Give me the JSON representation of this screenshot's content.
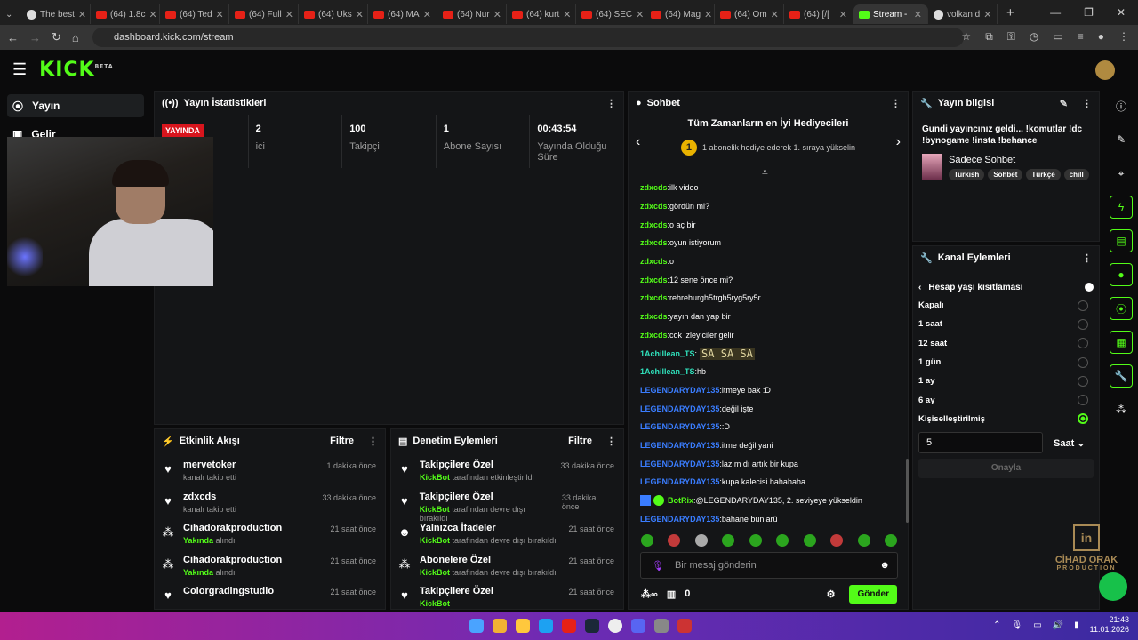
{
  "browser": {
    "tabs": [
      {
        "label": "The best",
        "kind": "g"
      },
      {
        "label": "(64) 1.8c",
        "kind": "yt"
      },
      {
        "label": "(64) Ted",
        "kind": "yt"
      },
      {
        "label": "(64) Full",
        "kind": "yt"
      },
      {
        "label": "(64) Uks",
        "kind": "yt"
      },
      {
        "label": "(64) MA",
        "kind": "yt"
      },
      {
        "label": "(64) Nur",
        "kind": "yt"
      },
      {
        "label": "(64) kurt",
        "kind": "yt"
      },
      {
        "label": "(64) SEC",
        "kind": "yt"
      },
      {
        "label": "(64) Mag",
        "kind": "yt"
      },
      {
        "label": "(64) Om",
        "kind": "yt"
      },
      {
        "label": "(64) [/[",
        "kind": "yt"
      },
      {
        "label": "Stream -",
        "kind": "active"
      },
      {
        "label": "volkan d",
        "kind": "g"
      }
    ],
    "url": "dashboard.kick.com/stream"
  },
  "brand": {
    "logo": "KICK",
    "beta": "BETA",
    "accent": "#53fc18"
  },
  "nav": {
    "stream": "Yayın",
    "income": "Gelir"
  },
  "stats": {
    "title": "Yayın İstatistikleri",
    "live_badge": "YAYINDA",
    "viewers_value": "2",
    "viewers_label": "ici",
    "followers_value": "100",
    "followers_label": "Takipçi",
    "subs_value": "1",
    "subs_label": "Abone Sayısı",
    "duration_value": "00:43:54",
    "duration_label": "Yayında Olduğu Süre"
  },
  "activity": {
    "title": "Etkinlik Akışı",
    "filter": "Filtre",
    "items": [
      {
        "icon": "heart-icon",
        "name": "mervetoker",
        "sub_pre": "",
        "sub_hl": "",
        "sub": "kanalı takip etti",
        "time": "1 dakika önce"
      },
      {
        "icon": "heart-icon",
        "name": "zdxcds",
        "sub_pre": "",
        "sub_hl": "",
        "sub": "kanalı takip etti",
        "time": "33 dakika önce"
      },
      {
        "icon": "gift-icon",
        "name": "Cihadorakproduction",
        "sub_pre": "",
        "sub_hl": "Yakında",
        "sub": " alındı",
        "time": "21 saat önce"
      },
      {
        "icon": "gift-icon",
        "name": "Cihadorakproduction",
        "sub_pre": "",
        "sub_hl": "Yakında",
        "sub": " alındı",
        "time": "21 saat önce"
      },
      {
        "icon": "heart-icon",
        "name": "Colorgradingstudio",
        "sub_pre": "",
        "sub_hl": "",
        "sub": "",
        "time": "21 saat önce"
      }
    ]
  },
  "moderation": {
    "title": "Denetim Eylemleri",
    "filter": "Filtre",
    "items": [
      {
        "icon": "heart-icon",
        "name": "Takipçilere Özel",
        "sub_hl": "KickBot",
        "sub": " tarafından etkinleştirildi",
        "time": "33 dakika önce"
      },
      {
        "icon": "heart-icon",
        "name": "Takipçilere Özel",
        "sub_hl": "KickBot",
        "sub": " tarafından devre dışı bırakıldı",
        "time": "33 dakika önce"
      },
      {
        "icon": "smile-icon",
        "name": "Yalnızca İfadeler",
        "sub_hl": "KickBot",
        "sub": " tarafından devre dışı bırakıldı",
        "time": "21 saat önce"
      },
      {
        "icon": "gift-icon",
        "name": "Abonelere Özel",
        "sub_hl": "KickBot",
        "sub": " tarafından devre dışı bırakıldı",
        "time": "21 saat önce"
      },
      {
        "icon": "heart-icon",
        "name": "Takipçilere Özel",
        "sub_hl": "KickBot",
        "sub": "",
        "time": "21 saat önce"
      }
    ]
  },
  "chat": {
    "title": "Sohbet",
    "gifters_title": "Tüm Zamanların en İyi Hediyecileri",
    "gifters_rank": "1",
    "gifters_sub": "1 abonelik hediye ederek 1. sıraya yükselin",
    "messages": [
      {
        "user": "zdxcds",
        "color": "g",
        "text": "ilk video"
      },
      {
        "user": "zdxcds",
        "color": "g",
        "text": "gördün mi?"
      },
      {
        "user": "zdxcds",
        "color": "g",
        "text": "o aç bir"
      },
      {
        "user": "zdxcds",
        "color": "g",
        "text": "oyun istiyorum"
      },
      {
        "user": "zdxcds",
        "color": "g",
        "text": "o"
      },
      {
        "user": "zdxcds",
        "color": "g",
        "text": "12 sene önce mi?"
      },
      {
        "user": "zdxcds",
        "color": "g",
        "text": "rehrehurgh5trgh5ryg5ry5r"
      },
      {
        "user": "zdxcds",
        "color": "g",
        "text": "yayın dan yap bir"
      },
      {
        "user": "zdxcds",
        "color": "g",
        "text": "cok izleyiciler gelir"
      },
      {
        "user": "1Achillean_TS",
        "color": "t",
        "text": "",
        "emote": "SA SA SA"
      },
      {
        "user": "1Achillean_TS",
        "color": "t",
        "text": "hb"
      },
      {
        "user": "LEGENDARYDAY135",
        "color": "b",
        "text": "itmeye bak :D"
      },
      {
        "user": "LEGENDARYDAY135",
        "color": "b",
        "text": "değil işte"
      },
      {
        "user": "LEGENDARYDAY135",
        "color": "b",
        "text": ":D"
      },
      {
        "user": "LEGENDARYDAY135",
        "color": "b",
        "text": "itme değil yani"
      },
      {
        "user": "LEGENDARYDAY135",
        "color": "b",
        "text": "lazım dı artık bir kupa"
      },
      {
        "user": "LEGENDARYDAY135",
        "color": "b",
        "text": "kupa kalecisi hahahaha"
      },
      {
        "user": "BotRix",
        "color": "g",
        "text": "@LEGENDARYDAY135, 2. seviyeye yükseldin",
        "bot": true
      },
      {
        "user": "LEGENDARYDAY135",
        "color": "b",
        "text": "bahane bunlarü"
      }
    ],
    "input_placeholder": "Bir mesaj gönderin",
    "points": "0",
    "send_label": "Gönder"
  },
  "stream_info": {
    "title": "Yayın bilgisi",
    "stream_title": "Gundi yayıncınız geldi... !komutlar !dc !bynogame !insta !behance",
    "category": "Sadece Sohbet",
    "tags": [
      "Turkish",
      "Sohbet",
      "Türkçe",
      "chill"
    ]
  },
  "channel_actions": {
    "title": "Kanal Eylemleri",
    "section": "Hesap yaşı kısıtlaması",
    "options": [
      {
        "label": "Kapalı",
        "selected": false
      },
      {
        "label": "1 saat",
        "selected": false
      },
      {
        "label": "12 saat",
        "selected": false
      },
      {
        "label": "1 gün",
        "selected": false
      },
      {
        "label": "1 ay",
        "selected": false
      },
      {
        "label": "6 ay",
        "selected": false
      },
      {
        "label": "Kişiselleştirilmiş",
        "selected": true
      }
    ],
    "custom_value": "5",
    "unit": "Saat",
    "confirm": "Onayla"
  },
  "watermark": {
    "line1": "CİHAD ORAK",
    "line2": "PRODUCTION"
  },
  "taskbar": {
    "time": "21:43",
    "date": "11.01.2026"
  }
}
